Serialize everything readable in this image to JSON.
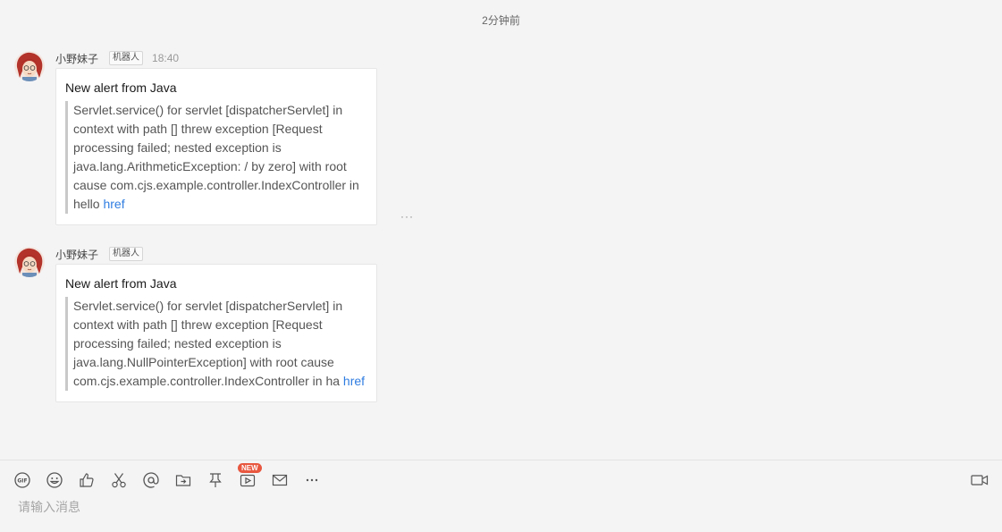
{
  "chat": {
    "time_divider": "2分钟前",
    "messages": [
      {
        "sender": "小野妹子",
        "badge": "机器人",
        "time": "18:40",
        "title": "New alert from Java",
        "body": "Servlet.service() for servlet [dispatcherServlet] in context with path [] threw exception [Request processing failed; nested exception is java.lang.ArithmeticException: / by zero] with root cause com.cjs.example.controller.IndexController in hello",
        "link": "href"
      },
      {
        "sender": "小野妹子",
        "badge": "机器人",
        "time": "",
        "title": "New alert from Java",
        "body": "Servlet.service() for servlet [dispatcherServlet] in context with path [] threw exception [Request processing failed; nested exception is java.lang.NullPointerException] with root cause com.cjs.example.controller.IndexController in ha",
        "link": "href"
      }
    ],
    "more_label": "···"
  },
  "composer": {
    "placeholder": "请输入消息",
    "new_badge": "NEW",
    "tools": [
      "gif-icon",
      "emoji-icon",
      "thumbs-up-icon",
      "scissors-icon",
      "at-icon",
      "folder-icon",
      "pin-icon",
      "video-play-icon",
      "mail-icon",
      "more-icon"
    ],
    "right_tool": "video-camera-icon",
    "icon_color": "#555555",
    "link_color": "#2f7de1",
    "badge_color": "#e8573f"
  }
}
